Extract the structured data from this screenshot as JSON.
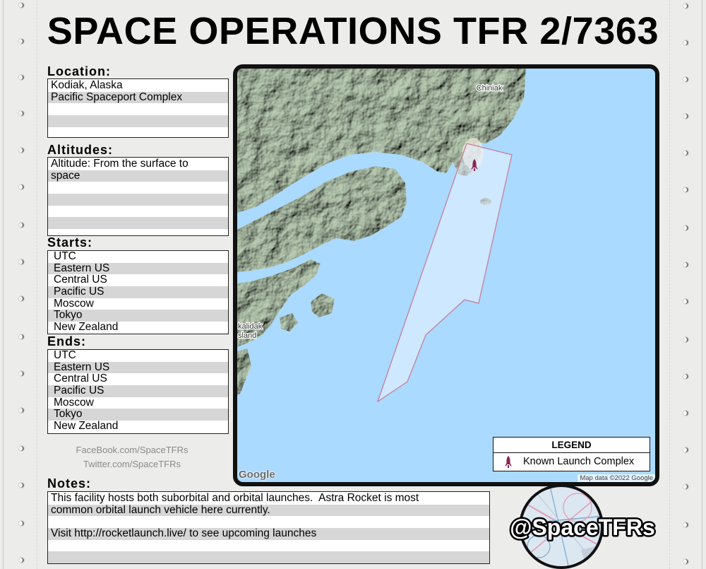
{
  "title": "SPACE OPERATIONS TFR 2/7363",
  "location": {
    "label": "Location:",
    "lines": [
      "Kodiak, Alaska",
      "Pacific Spaceport Complex"
    ]
  },
  "altitudes": {
    "label": "Altitudes:",
    "lines": [
      "Altitude: From the surface to",
      "space"
    ]
  },
  "starts": {
    "label": "Starts:",
    "zones": [
      "UTC",
      "Eastern US",
      "Central US",
      "Pacific US",
      "Moscow",
      "Tokyo",
      "New Zealand"
    ]
  },
  "ends": {
    "label": "Ends:",
    "zones": [
      "UTC",
      "Eastern US",
      "Central US",
      "Pacific US",
      "Moscow",
      "Tokyo",
      "New Zealand"
    ]
  },
  "social": [
    "FaceBook.com/SpaceTFRs",
    "Twitter.com/SpaceTFRs"
  ],
  "notes": {
    "label": "Notes:",
    "lines": [
      "This facility hosts both suborbital and orbital launches.  Astra Rocket is most",
      "common orbital launch vehicle here currently.",
      "Visit http://rocketlaunch.live/ to see upcoming launches"
    ]
  },
  "map": {
    "place_labels": [
      "Chiniak",
      "kalidak",
      "sland"
    ],
    "legend": {
      "title": "LEGEND",
      "items": [
        {
          "icon": "rocket-icon",
          "label": "Known Launch Complex"
        }
      ]
    },
    "google_logo": "Google",
    "attribution": "Map data ©2022 Google",
    "colors": {
      "water": "#aadaff",
      "land": "#bccfb6",
      "tfr": "#c77e98",
      "marker": "#8a2457"
    }
  },
  "badge": {
    "handle": "@SpaceTFRs"
  },
  "colors": {
    "paper": "#ececea",
    "stripe": "#d6d6d6",
    "box-border": "#222222",
    "social": "#8a8a8a"
  }
}
